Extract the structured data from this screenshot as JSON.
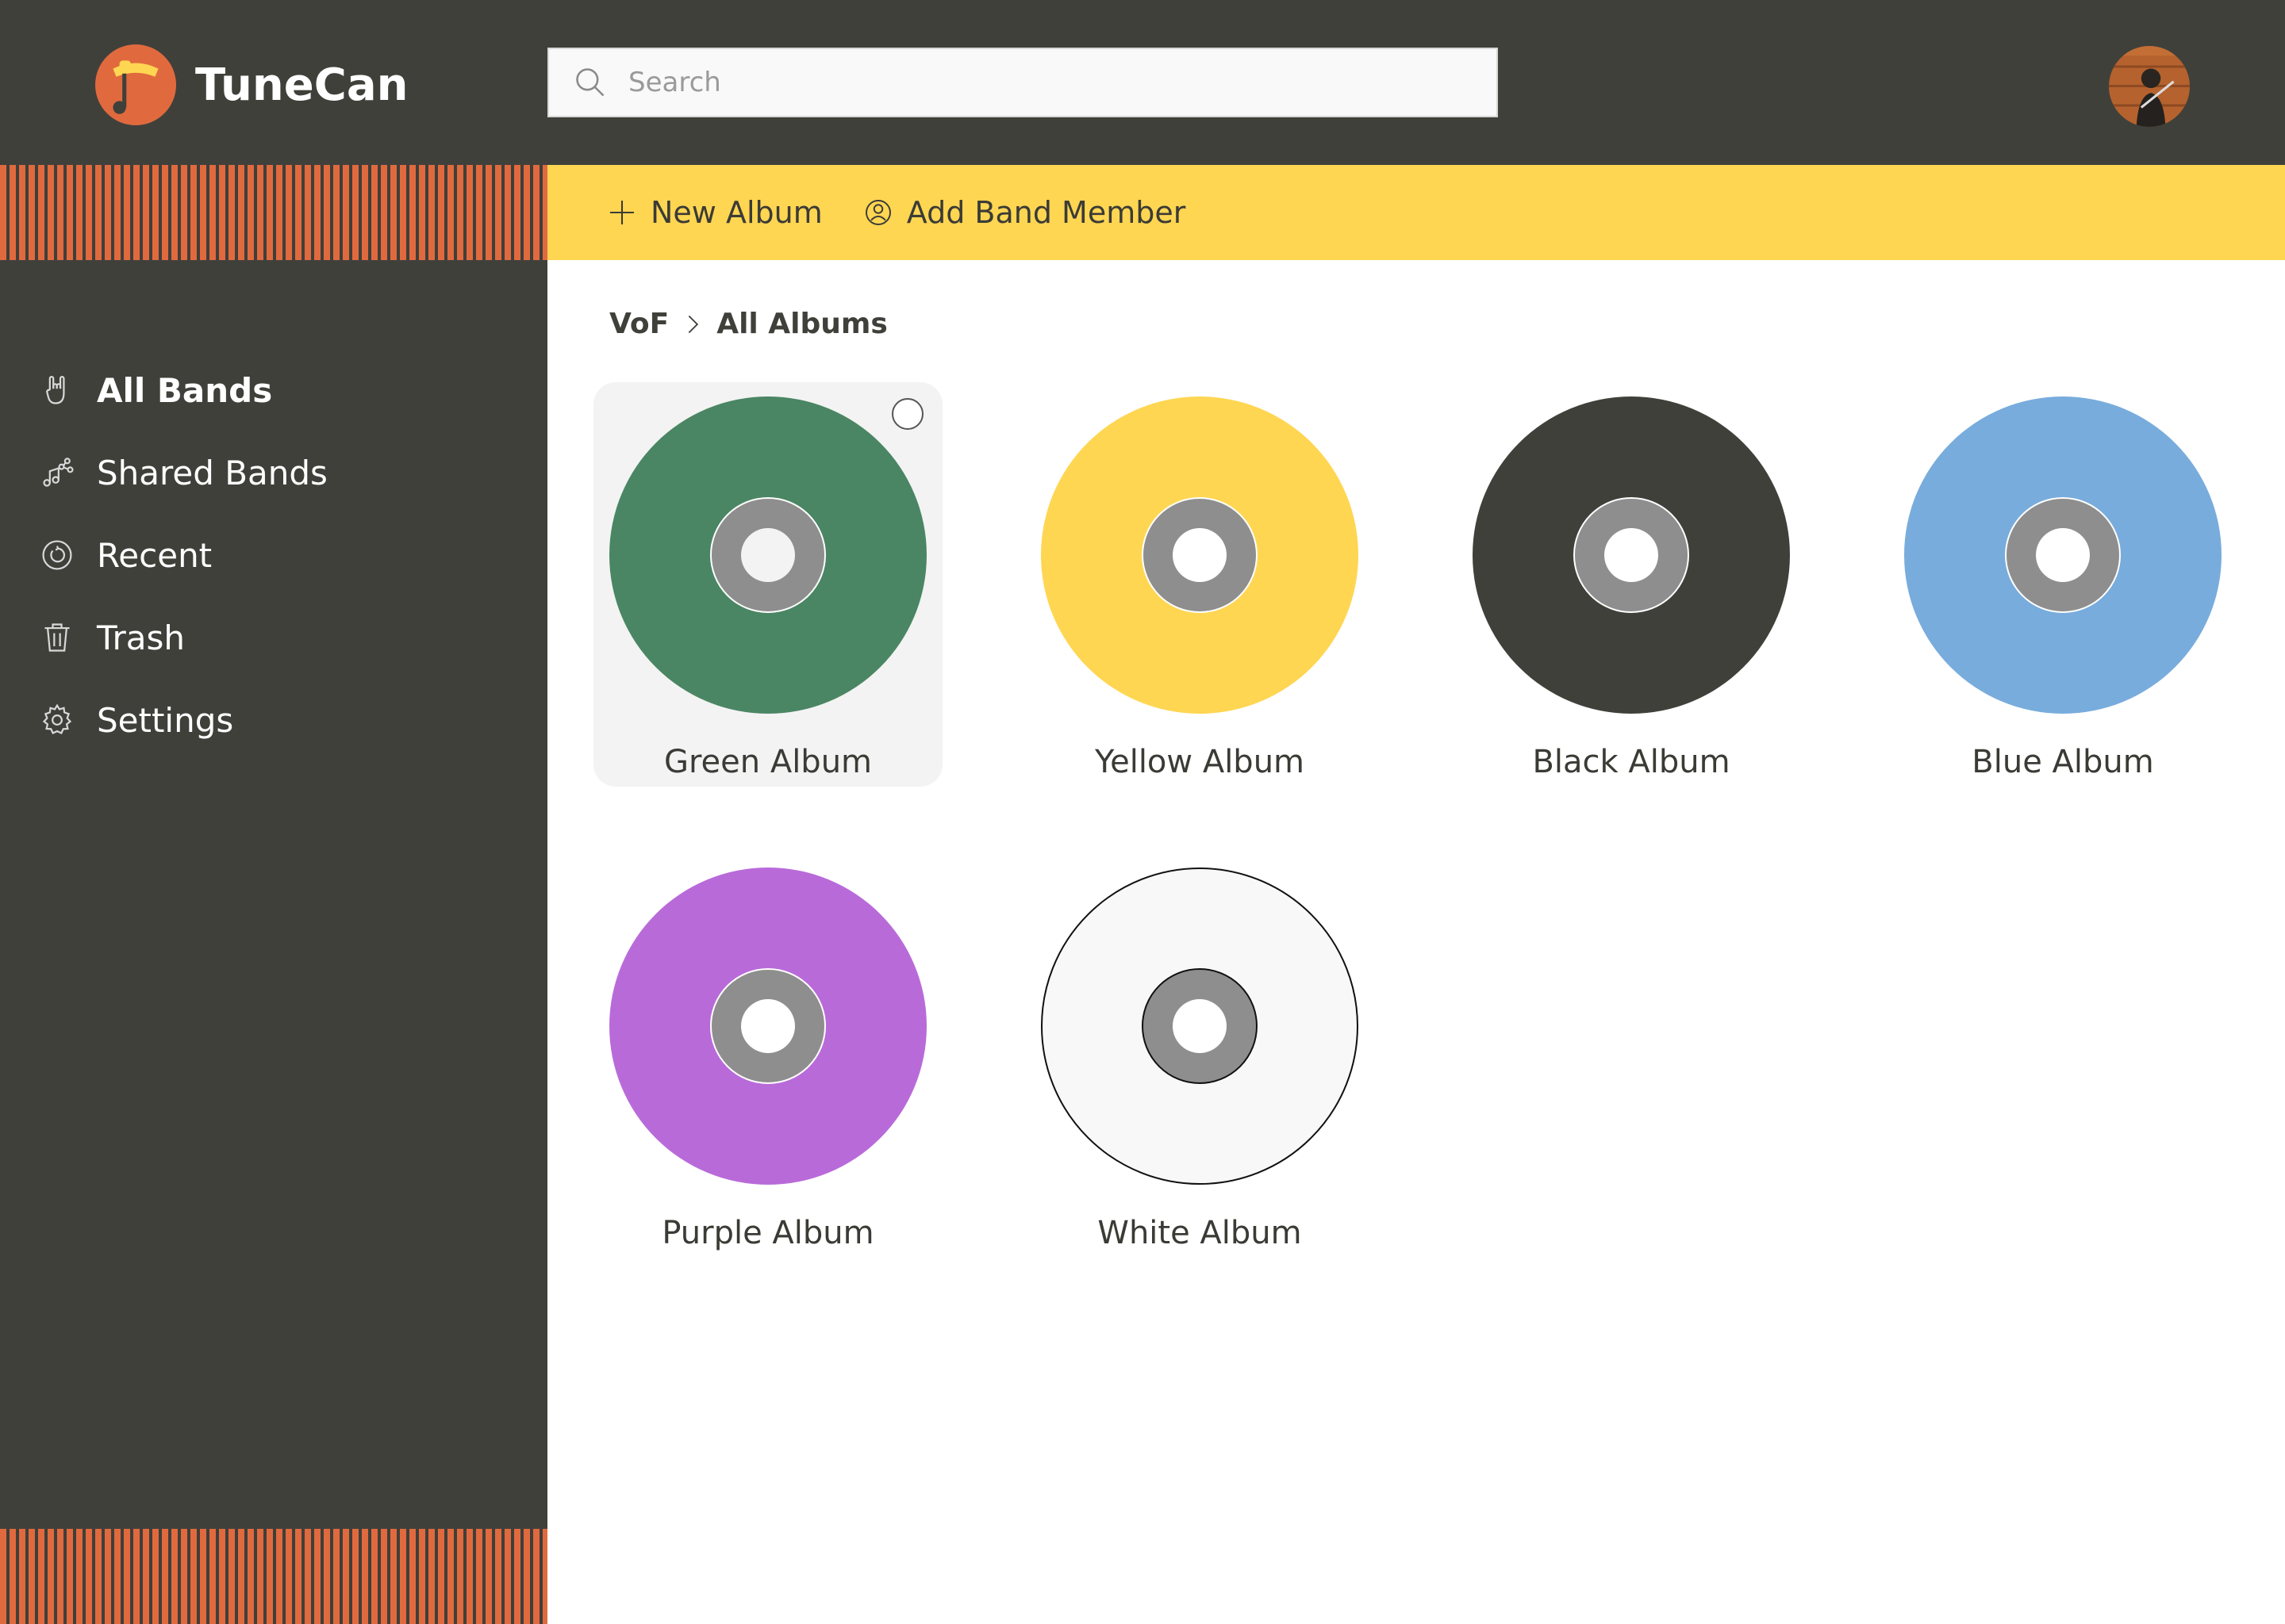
{
  "app": {
    "name": "TuneCan"
  },
  "search": {
    "placeholder": "Search",
    "value": ""
  },
  "sidebar": {
    "items": [
      {
        "label": "All Bands",
        "icon": "rock-hand-icon",
        "active": true
      },
      {
        "label": "Shared Bands",
        "icon": "share-music-icon",
        "active": false
      },
      {
        "label": "Recent",
        "icon": "recent-clock-icon",
        "active": false
      },
      {
        "label": "Trash",
        "icon": "trash-icon",
        "active": false
      },
      {
        "label": "Settings",
        "icon": "gear-icon",
        "active": false
      }
    ]
  },
  "actions": {
    "new_album": "New Album",
    "add_band_member": "Add Band Member"
  },
  "breadcrumb": {
    "root": "VoF",
    "current": "All Albums"
  },
  "albums": [
    {
      "label": "Green Album",
      "color": "#4a8663",
      "selected": true
    },
    {
      "label": "Yellow Album",
      "color": "#ffd652",
      "selected": false
    },
    {
      "label": "Black Album",
      "color": "#40403b",
      "selected": false
    },
    {
      "label": "Blue Album",
      "color": "#78acdc",
      "selected": false
    },
    {
      "label": "Purple Album",
      "color": "#b96ad9",
      "selected": false
    },
    {
      "label": "White Album",
      "color": "#f8f8f8",
      "selected": false
    }
  ],
  "colors": {
    "chrome": "#40403b",
    "accent_orange": "#e06a3e",
    "action_bar": "#ffd652"
  }
}
